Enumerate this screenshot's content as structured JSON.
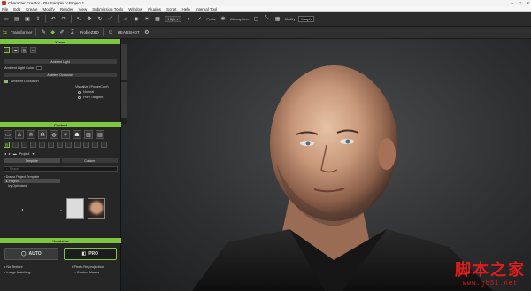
{
  "window": {
    "title": "Character Creator - DH Sample.ccProject *"
  },
  "menu": [
    "File",
    "Edit",
    "Create",
    "Modify",
    "Render",
    "View",
    "Submission Tools",
    "Window",
    "Plugins",
    "Script",
    "Help",
    "Internal Tool"
  ],
  "toolbar1": {
    "quality": "High",
    "probe_label": "Probe",
    "atmosphere_label": "Atmosphere",
    "modify_label": "Modify",
    "morph_label": "Morph"
  },
  "toolbar2": {
    "transformer_label": "Transformer",
    "profile_label": "ProfileZBD",
    "headshot_label": "HEADSHOT"
  },
  "visual_panel": {
    "header": "Visual",
    "ambient_light": "Ambient Light",
    "ambient_light_color": "Ambient Light Color",
    "ambient_occlusion_head": "Ambient Occlusion",
    "ambient_occlusion_chk": "Ambient Occlusion",
    "visualize_label": "Visualize (PowerCore)",
    "opt_normal": "Normal",
    "opt_pbr": "PBR Tangent"
  },
  "content_panel": {
    "header": "Content",
    "breadcrumb": "Project",
    "tab_template": "Template",
    "tab_custom": "Custom",
    "search_placeholder": "Search",
    "tree": [
      "Drama Project Template",
      "Project",
      "Ivy Optimized"
    ]
  },
  "headshot_panel": {
    "header": "Headshot",
    "auto_label": "AUTO",
    "pro_label": "PRO",
    "opt_no_texture": "No Texture",
    "opt_photo_reprojection": "Photo Re-projection",
    "opt_image_matching": "Image Matching",
    "opt_custom_mask": "Custom Masks"
  },
  "watermark": {
    "big": "脚本之家",
    "small": "www.jb51.net"
  },
  "colors": {
    "accent": "#7ec63f",
    "panel_bg": "#262626",
    "watermark": "#e21b1b"
  }
}
